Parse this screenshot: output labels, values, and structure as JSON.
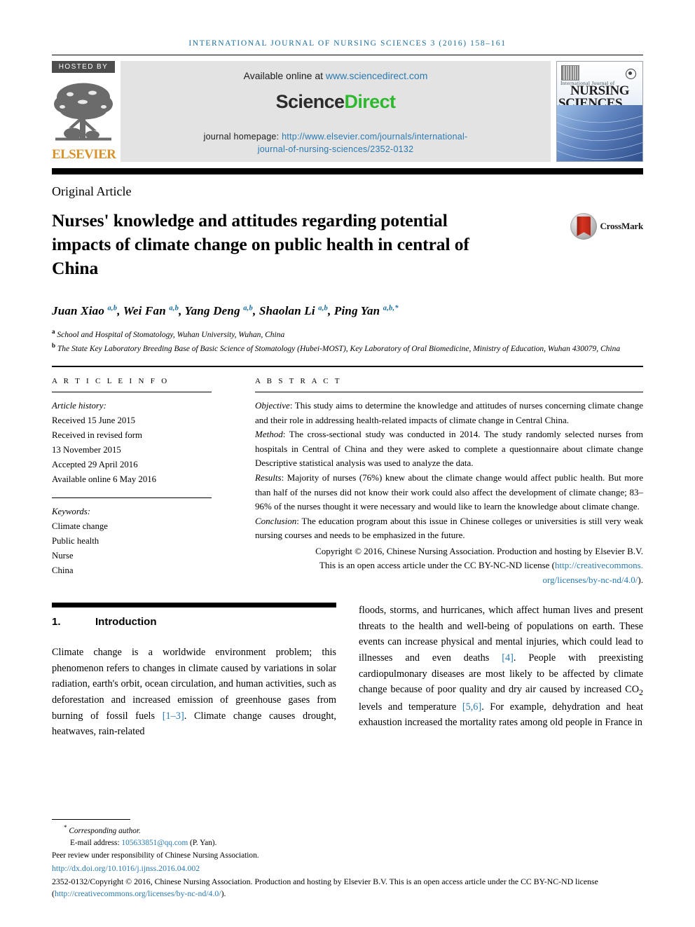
{
  "running_head": "international journal of nursing sciences 3 (2016) 158–161",
  "masthead": {
    "hosted_by": "HOSTED BY",
    "elsevier_wordmark": "ELSEVIER",
    "available_label": "Available online at ",
    "available_link": "www.sciencedirect.com",
    "brand_first": "Science",
    "brand_second": "Direct",
    "homepage_label": "journal homepage: ",
    "homepage_link_line1": "http://www.elsevier.com/journals/international-",
    "homepage_link_line2": "journal-of-nursing-sciences/2352-0132",
    "cover": {
      "subtitle": "International Journal of",
      "line1": "NURSING",
      "line2": "SCIENCES"
    }
  },
  "article": {
    "type": "Original Article",
    "title": "Nurses' knowledge and attitudes regarding potential impacts of climate change on public health in central of China",
    "crossmark_label": "CrossMark",
    "authors": [
      {
        "name": "Juan Xiao",
        "sup": "a,b"
      },
      {
        "name": "Wei Fan",
        "sup": "a,b"
      },
      {
        "name": "Yang Deng",
        "sup": "a,b"
      },
      {
        "name": "Shaolan Li",
        "sup": "a,b"
      },
      {
        "name": "Ping Yan",
        "sup": "a,b,*"
      }
    ],
    "affiliations": [
      {
        "marker": "a",
        "text": "School and Hospital of Stomatology, Wuhan University, Wuhan, China"
      },
      {
        "marker": "b",
        "text": "The State Key Laboratory Breeding Base of Basic Science of Stomatology (Hubei-MOST), Key Laboratory of Oral Biomedicine, Ministry of Education, Wuhan 430079, China"
      }
    ]
  },
  "info": {
    "heading": "A R T I C L E   I N F O",
    "history_label": "Article history:",
    "history": [
      "Received 15 June 2015",
      "Received in revised form",
      "13 November 2015",
      "Accepted 29 April 2016",
      "Available online 6 May 2016"
    ],
    "keywords_label": "Keywords:",
    "keywords": [
      "Climate change",
      "Public health",
      "Nurse",
      "China"
    ]
  },
  "abstract": {
    "heading": "A B S T R A C T",
    "objective_label": "Objective",
    "objective_text": ": This study aims to determine the knowledge and attitudes of nurses concerning climate change and their role in addressing health-related impacts of climate change in Central China.",
    "method_label": "Method",
    "method_text": ": The cross-sectional study was conducted in 2014. The study randomly selected nurses from hospitals in Central of China and they were asked to complete a questionnaire about climate change Descriptive statistical analysis was used to analyze the data.",
    "results_label": "Results",
    "results_text": ": Majority of nurses (76%) knew about the climate change would affect public health. But more than half of the nurses did not know their work could also affect the development of climate change; 83–96% of the nurses thought it were necessary and would like to learn the knowledge about climate change.",
    "conclusion_label": "Conclusion",
    "conclusion_text": ": The education program about this issue in Chinese colleges or universities is still very weak nursing courses and needs to be emphasized in the future.",
    "copyright_line1": "Copyright © 2016, Chinese Nursing Association. Production and hosting by Elsevier B.V.",
    "copyright_line2": "This is an open access article under the CC BY-NC-ND license (",
    "copyright_link1": "http://creativecommons.",
    "copyright_link2": "org/licenses/by-nc-nd/4.0/",
    "copyright_tail": ")."
  },
  "introduction": {
    "number": "1.",
    "heading": "Introduction",
    "left_paragraph_pre": "Climate change is a worldwide environment problem; this phenomenon refers to changes in climate caused by variations in solar radiation, earth's orbit, ocean circulation, and human activities, such as deforestation and increased emission of greenhouse gases from burning of fossil fuels ",
    "left_ref1": "[1–3]",
    "left_paragraph_post": ". Climate change causes drought, heatwaves, rain-related",
    "right_paragraph_pre": "floods, storms, and hurricanes, which affect human lives and present threats to the health and well-being of populations on earth. These events can increase physical and mental injuries, which could lead to illnesses and even deaths ",
    "right_ref1": "[4]",
    "right_paragraph_mid": ". People with preexisting cardiopulmonary diseases are most likely to be affected by climate change because of poor quality and dry air caused by increased CO",
    "right_sub": "2",
    "right_paragraph_mid2": " levels and temperature ",
    "right_ref2": "[5,6]",
    "right_paragraph_post": ". For example, dehydration and heat exhaustion increased the mortality rates among old people in France in"
  },
  "footer": {
    "corresponding_marker": "*",
    "corresponding_label": "Corresponding author.",
    "email_label": "E-mail address: ",
    "email_link": "105633851@qq.com",
    "email_tail": " (P. Yan).",
    "peer_review": "Peer review under responsibility of Chinese Nursing Association.",
    "doi": "http://dx.doi.org/10.1016/j.ijnss.2016.04.002",
    "license_pre": "2352-0132/Copyright © 2016, Chinese Nursing Association. Production and hosting by Elsevier B.V. This is an open access article under the CC BY-NC-ND license (",
    "license_link": "http://creativecommons.org/licenses/by-nc-nd/4.0/",
    "license_tail": ")."
  },
  "colors": {
    "link_blue": "#2a7ab0",
    "running_head_blue": "#1a6d9e",
    "sciencedirect_green": "#2eb82e",
    "elsevier_orange": "#d9922b",
    "hosted_by_bg": "#4d4d4d"
  }
}
